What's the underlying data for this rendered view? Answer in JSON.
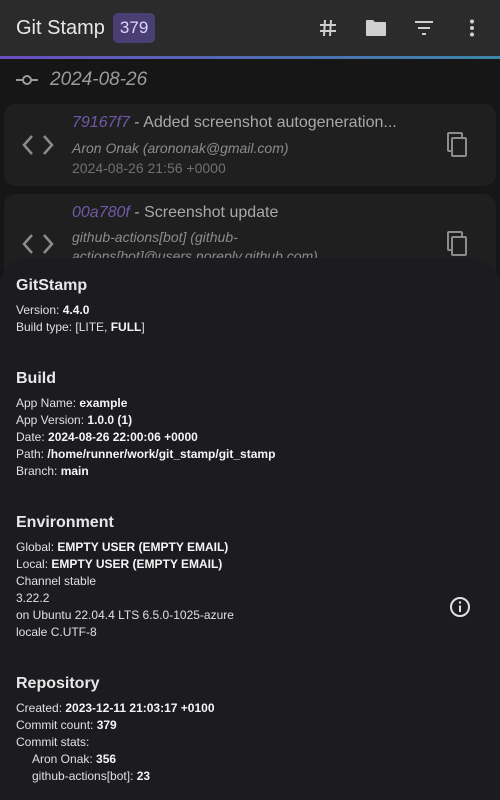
{
  "appbar": {
    "title": "Git Stamp",
    "commit_count": "379",
    "actions": [
      "hash-icon",
      "folder-icon",
      "filter-icon",
      "more-vert-icon"
    ]
  },
  "date_group": {
    "date": "2024-08-26"
  },
  "commits": [
    {
      "hash": "79167f7",
      "separator": " - ",
      "message": "Added screenshot autogeneration...",
      "author": "Aron Onak (arononak@gmail.com)",
      "date": "2024-08-26 21:56 +0000"
    },
    {
      "hash": "00a780f",
      "separator": " - ",
      "message": "Screenshot update",
      "author_line1": "github-actions[bot] (github-",
      "author_line2": "actions[bot]@users.noreply.github.com)"
    }
  ],
  "sheet": {
    "app": {
      "heading": "GitStamp",
      "version_label": "Version: ",
      "version_value": "4.4.0",
      "build_type_label": "Build type: [LITE, ",
      "build_type_value": "FULL",
      "build_type_end": "]"
    },
    "build": {
      "heading": "Build",
      "rows": [
        {
          "label": "App Name: ",
          "value": "example"
        },
        {
          "label": "App Version: ",
          "value": "1.0.0 (1)"
        },
        {
          "label": "Date: ",
          "value": "2024-08-26 22:00:06 +0000"
        },
        {
          "label": "Path: ",
          "value": "/home/runner/work/git_stamp/git_stamp"
        },
        {
          "label": "Branch: ",
          "value": "main"
        }
      ]
    },
    "environment": {
      "heading": "Environment",
      "global_label": "Global: ",
      "global_value": "EMPTY USER (EMPTY EMAIL)",
      "local_label": "Local: ",
      "local_value": "EMPTY USER (EMPTY EMAIL)",
      "lines": [
        "Channel stable",
        "3.22.2",
        "on Ubuntu 22.04.4 LTS 6.5.0-1025-azure",
        "locale C.UTF-8"
      ]
    },
    "repository": {
      "heading": "Repository",
      "created_label": "Created: ",
      "created_value": "2023-12-11 21:03:17 +0100",
      "count_label": "Commit count: ",
      "count_value": "379",
      "stats_label": "Commit stats:",
      "stats": [
        {
          "label": "Aron Onak: ",
          "value": "356"
        },
        {
          "label": "github-actions[bot]: ",
          "value": "23"
        }
      ]
    }
  },
  "colors": {
    "appbar_bg": "#2b2b2b",
    "badge_bg": "#4a3f73",
    "hash": "#6e5aa8",
    "sheet_bg": "#1c1b1f",
    "page_bg": "#161616"
  }
}
